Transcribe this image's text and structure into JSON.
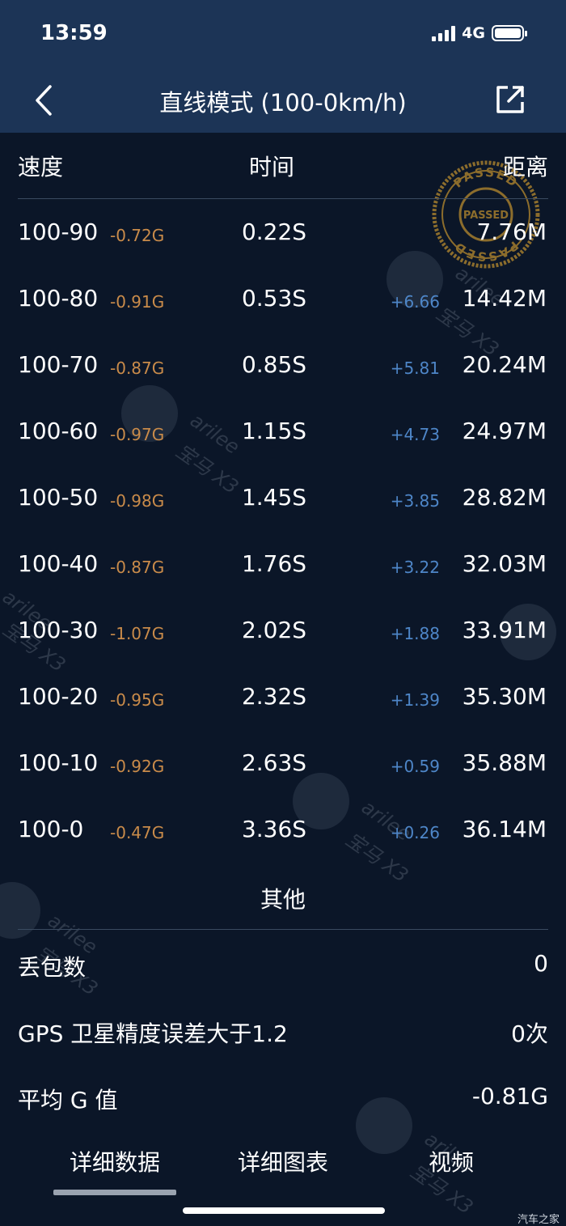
{
  "status_bar": {
    "time": "13:59",
    "network": "4G"
  },
  "nav": {
    "title": "直线模式 (100-0km/h)"
  },
  "table_header": {
    "speed": "速度",
    "time": "时间",
    "distance": "距离"
  },
  "rows": [
    {
      "speed": "100-90",
      "g": "-0.72G",
      "time": "0.22S",
      "delta": "",
      "distance": "7.76M"
    },
    {
      "speed": "100-80",
      "g": "-0.91G",
      "time": "0.53S",
      "delta": "+6.66",
      "distance": "14.42M"
    },
    {
      "speed": "100-70",
      "g": "-0.87G",
      "time": "0.85S",
      "delta": "+5.81",
      "distance": "20.24M"
    },
    {
      "speed": "100-60",
      "g": "-0.97G",
      "time": "1.15S",
      "delta": "+4.73",
      "distance": "24.97M"
    },
    {
      "speed": "100-50",
      "g": "-0.98G",
      "time": "1.45S",
      "delta": "+3.85",
      "distance": "28.82M"
    },
    {
      "speed": "100-40",
      "g": "-0.87G",
      "time": "1.76S",
      "delta": "+3.22",
      "distance": "32.03M"
    },
    {
      "speed": "100-30",
      "g": "-1.07G",
      "time": "2.02S",
      "delta": "+1.88",
      "distance": "33.91M"
    },
    {
      "speed": "100-20",
      "g": "-0.95G",
      "time": "2.32S",
      "delta": "+1.39",
      "distance": "35.30M"
    },
    {
      "speed": "100-10",
      "g": "-0.92G",
      "time": "2.63S",
      "delta": "+0.59",
      "distance": "35.88M"
    },
    {
      "speed": "100-0",
      "g": "-0.47G",
      "time": "3.36S",
      "delta": "+0.26",
      "distance": "36.14M"
    }
  ],
  "other": {
    "title": "其他",
    "stats": [
      {
        "label": "丢包数",
        "value": "0"
      },
      {
        "label": "GPS 卫星精度误差大于1.2",
        "value": "0次"
      },
      {
        "label": "平均 G 值",
        "value": "-0.81G"
      }
    ]
  },
  "tabs": [
    {
      "label": "详细数据",
      "active": true
    },
    {
      "label": "详细图表",
      "active": false
    },
    {
      "label": "视频",
      "active": false
    }
  ],
  "stamp": {
    "text": "PASSED"
  },
  "watermarks": {
    "user": "arilee",
    "car": "宝马 X3",
    "site": "汽车之家"
  },
  "colors": {
    "background": "#0b1628",
    "header": "#1c3456",
    "g_value": "#c98b4a",
    "delta": "#4e86c8"
  }
}
